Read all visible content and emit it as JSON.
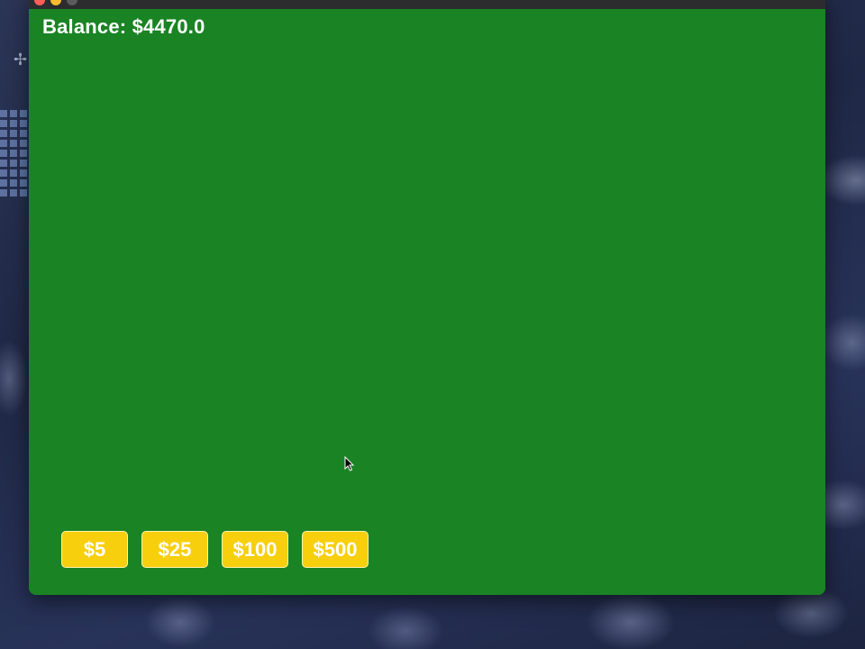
{
  "window": {
    "title": ""
  },
  "game": {
    "balance_label": "Balance: $4470.0"
  },
  "chips": [
    {
      "label": "$5"
    },
    {
      "label": "$25"
    },
    {
      "label": "$100"
    },
    {
      "label": "$500"
    }
  ],
  "colors": {
    "table_felt": "#1a8324",
    "chip": "#f8cf0d",
    "chip_text": "#ffffff"
  }
}
